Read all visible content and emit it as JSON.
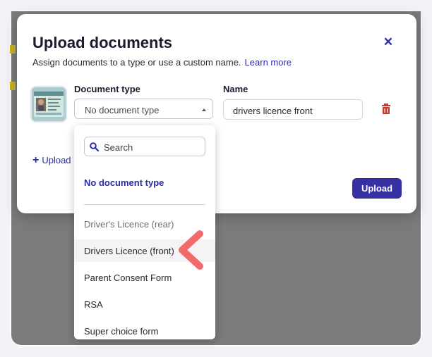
{
  "modal": {
    "title": "Upload documents",
    "subtitle": "Assign documents to a type or use a custom name.",
    "learn_more": "Learn more",
    "close_icon": "close-icon"
  },
  "document_row": {
    "type_label": "Document type",
    "type_value": "No document type",
    "name_label": "Name",
    "name_value": "drivers licence front",
    "delete_icon": "trash-icon"
  },
  "actions": {
    "upload_more": "Upload",
    "upload_button": "Upload"
  },
  "dropdown": {
    "search_placeholder": "Search",
    "selected_option": "No document type",
    "options": [
      "Driver's Licence (rear)",
      "Drivers Licence (front)",
      "Parent Consent Form",
      "RSA",
      "Super choice form"
    ]
  },
  "colors": {
    "accent": "#3730a3",
    "link": "#2b2ba5",
    "danger": "#c0392b",
    "annotation_arrow": "#f26b6b"
  }
}
